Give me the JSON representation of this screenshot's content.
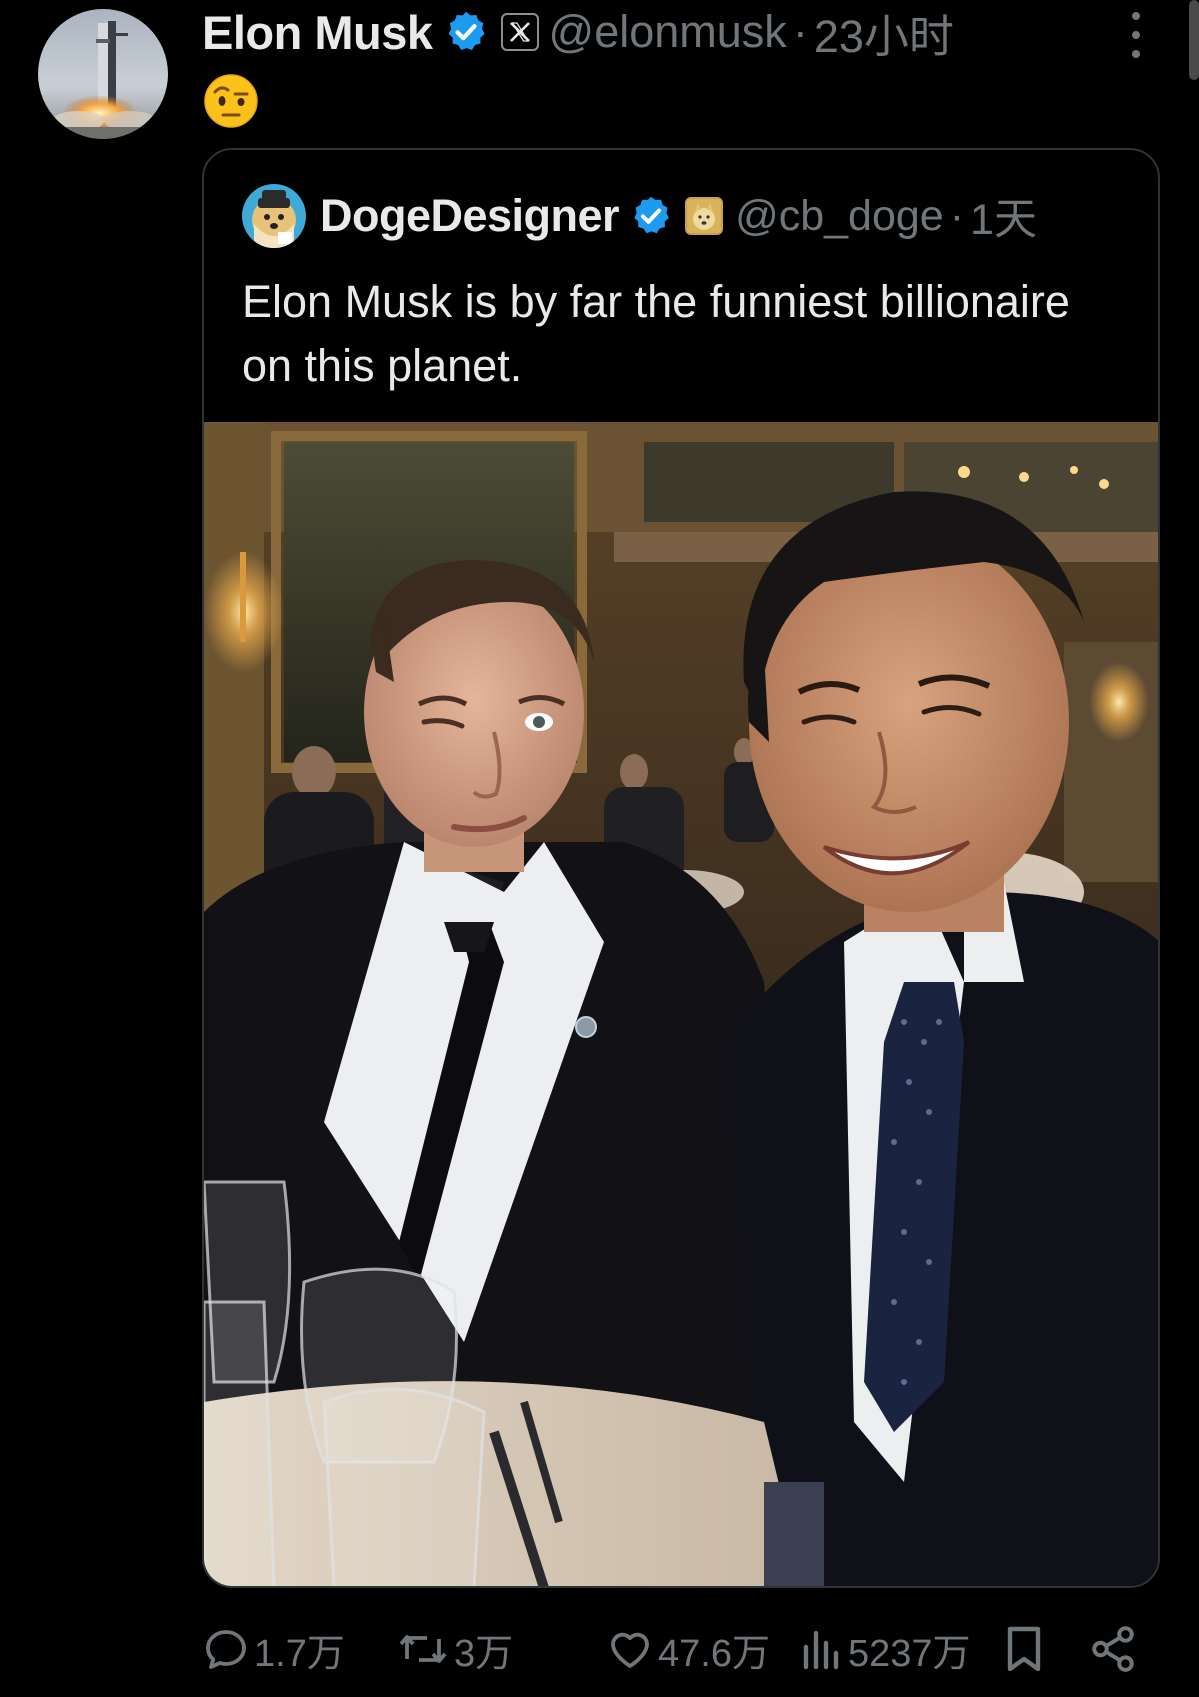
{
  "post": {
    "author_name": "Elon Musk",
    "handle": "@elonmusk",
    "separator": "·",
    "time": "23小时",
    "emoji_text": "🤨"
  },
  "quote": {
    "author_name": "DogeDesigner",
    "handle": "@cb_doge",
    "separator": "·",
    "time": "1天",
    "text": "Elon Musk is by far the funniest billionaire on this planet."
  },
  "actions": {
    "replies": "1.7万",
    "reposts": "3万",
    "likes": "47.6万",
    "views": "5237万"
  },
  "icons": {
    "verified": "verified-badge-icon",
    "org": "x-logo-icon",
    "more": "more-options-icon",
    "reply": "reply-icon",
    "repost": "repost-icon",
    "like": "heart-icon",
    "views": "analytics-icon",
    "bookmark": "bookmark-icon",
    "share": "share-icon"
  },
  "colors": {
    "background": "#000000",
    "primary_text": "#e7e9ea",
    "secondary_text": "#71767b",
    "verified_blue": "#1d9bf0",
    "border": "#2f3336"
  }
}
